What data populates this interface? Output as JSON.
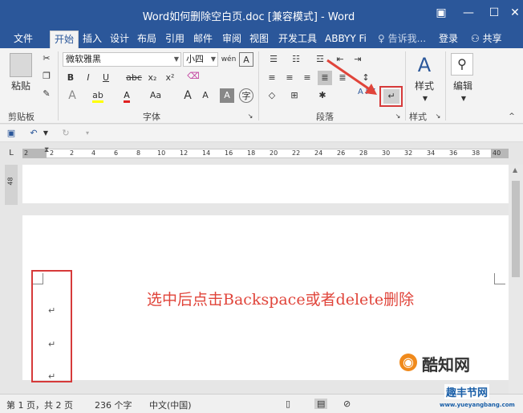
{
  "window": {
    "title": "Word如何删除空白页.doc [兼容模式] - Word",
    "controls": {
      "restore": "▣",
      "minimize": "—",
      "close": "✕"
    }
  },
  "tabs": [
    {
      "label": "文件"
    },
    {
      "label": "开始"
    },
    {
      "label": "插入"
    },
    {
      "label": "设计"
    },
    {
      "label": "布局"
    },
    {
      "label": "引用"
    },
    {
      "label": "邮件"
    },
    {
      "label": "审阅"
    },
    {
      "label": "视图"
    },
    {
      "label": "开发工具"
    },
    {
      "label": "ABBYY Fi"
    },
    {
      "label": "告诉我..."
    },
    {
      "label": "登录"
    },
    {
      "label": "共享"
    }
  ],
  "ribbon": {
    "clipboard": {
      "paste": "粘贴",
      "label": "剪贴板"
    },
    "font": {
      "font_name": "微软雅黑",
      "font_size": "小四",
      "phonetic": "wén",
      "bold": "B",
      "italic": "I",
      "underline": "U",
      "strike": "abc",
      "subscript": "x₂",
      "superscript": "x²",
      "grow": "A",
      "shrink": "A",
      "aa": "Aa",
      "font_color": "A",
      "char_shade": "A",
      "enclose": "字",
      "label": "字体"
    },
    "paragraph": {
      "label": "段落",
      "sort": "A↓Z",
      "show_marks": "↵"
    },
    "styles": {
      "button": "样式",
      "label": "样式"
    },
    "editing": {
      "button": "编辑"
    }
  },
  "ruler": {
    "ticks": [
      "2",
      "2",
      "2",
      "4",
      "6",
      "8",
      "10",
      "12",
      "14",
      "16",
      "18",
      "20",
      "22",
      "24",
      "26",
      "28",
      "30",
      "32",
      "34",
      "36",
      "38",
      "40"
    ],
    "vertical": "48"
  },
  "document": {
    "paragraph_mark": "↵",
    "annotation": "选中后点击Backspace或者delete删除"
  },
  "status": {
    "page": "第 1 页，共 2 页",
    "words": "236 个字",
    "language": "中文(中国)"
  },
  "watermark": {
    "logo_text": "酷知网",
    "site_text": "趣丰节网",
    "url": "www.yueyangbang.com"
  },
  "colors": {
    "ribbon_blue": "#2b579a",
    "highlight_red": "#d63a3a"
  }
}
